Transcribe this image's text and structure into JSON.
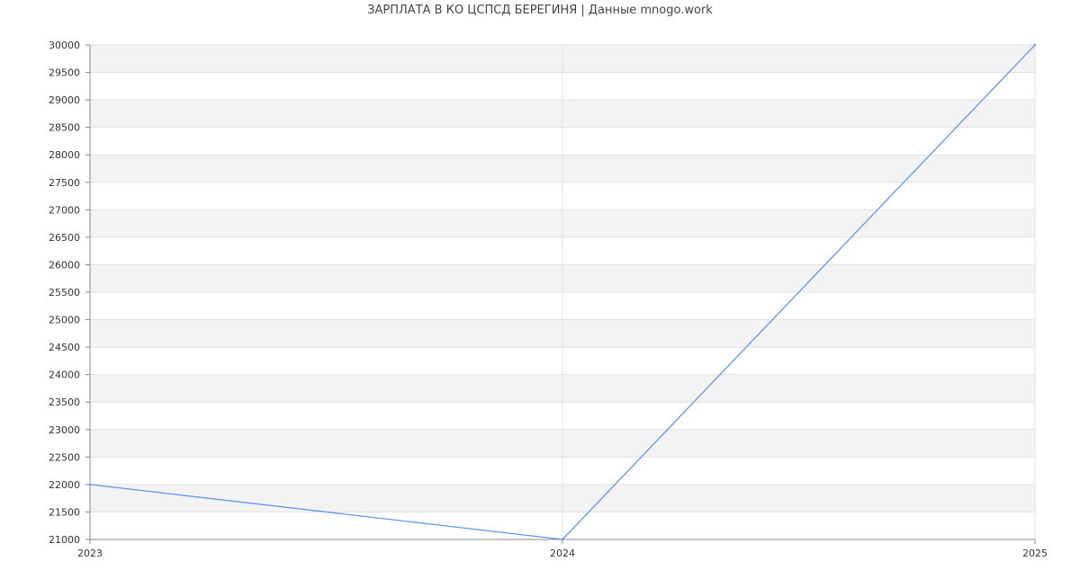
{
  "chart_data": {
    "type": "line",
    "title": "ЗАРПЛАТА В КО ЦСПСД БЕРЕГИНЯ | Данные mnogo.work",
    "xlabel": "",
    "ylabel": "",
    "x": [
      "2023",
      "2024",
      "2025"
    ],
    "series": [
      {
        "values": [
          22000,
          21000,
          30000
        ]
      }
    ],
    "ylim": [
      21000,
      30000
    ],
    "ytick_step": 500,
    "grid": true,
    "colors": {
      "line": "#6495ED",
      "band": "#F3F3F3",
      "grid": "#E2E2E2",
      "axis": "#888888",
      "tick_text": "#333333"
    }
  }
}
